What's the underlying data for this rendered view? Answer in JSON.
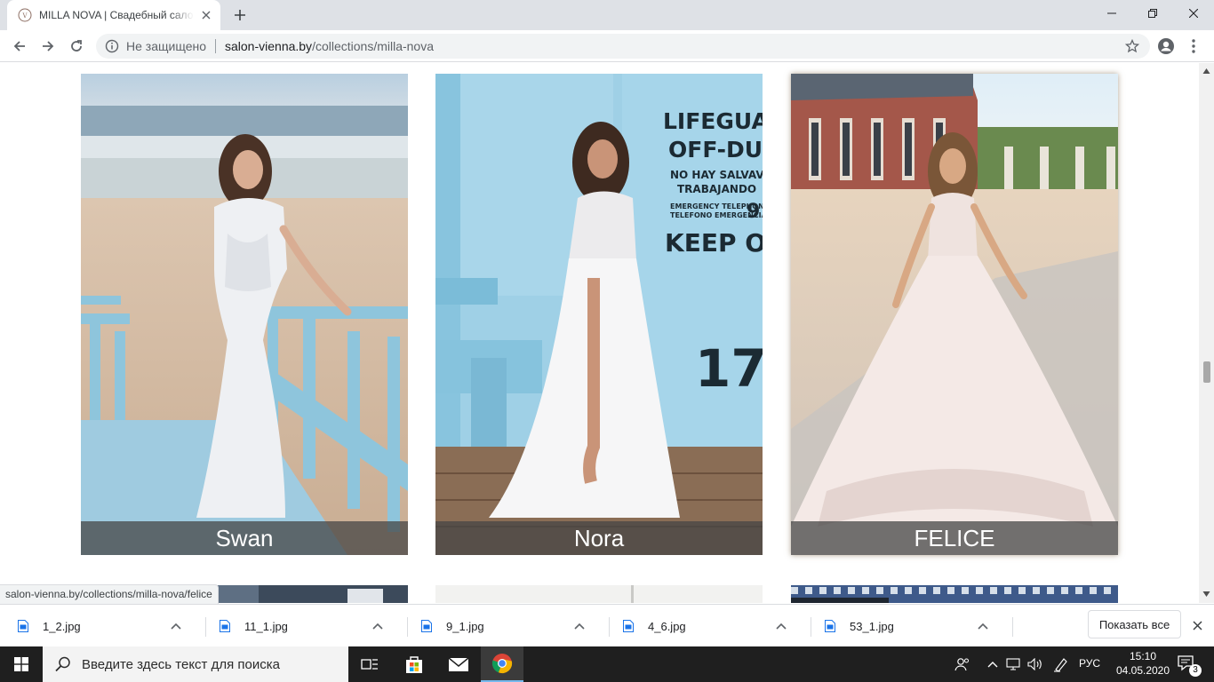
{
  "browser": {
    "tab_title": "MILLA NOVA | Свадебный салон",
    "security_label": "Не защищено",
    "url_domain": "salon-vienna.by",
    "url_path": "/collections/milla-nova",
    "status_url": "salon-vienna.by/collections/milla-nova/felice"
  },
  "gallery": {
    "cards": [
      {
        "name": "Swan"
      },
      {
        "name": "Nora"
      },
      {
        "name": "FELICE"
      }
    ]
  },
  "downloads": {
    "items": [
      {
        "file": "1_2.jpg"
      },
      {
        "file": "11_1.jpg"
      },
      {
        "file": "9_1.jpg"
      },
      {
        "file": "4_6.jpg"
      },
      {
        "file": "53_1.jpg"
      }
    ],
    "show_all": "Показать все"
  },
  "taskbar": {
    "search_placeholder": "Введите здесь текст для поиска",
    "language": "РУС",
    "time": "15:10",
    "date": "04.05.2020",
    "notification_count": "3"
  },
  "colors": {
    "accent": "#1a73e8",
    "caption_overlay": "#464646",
    "taskbar": "#1f1f1f"
  }
}
